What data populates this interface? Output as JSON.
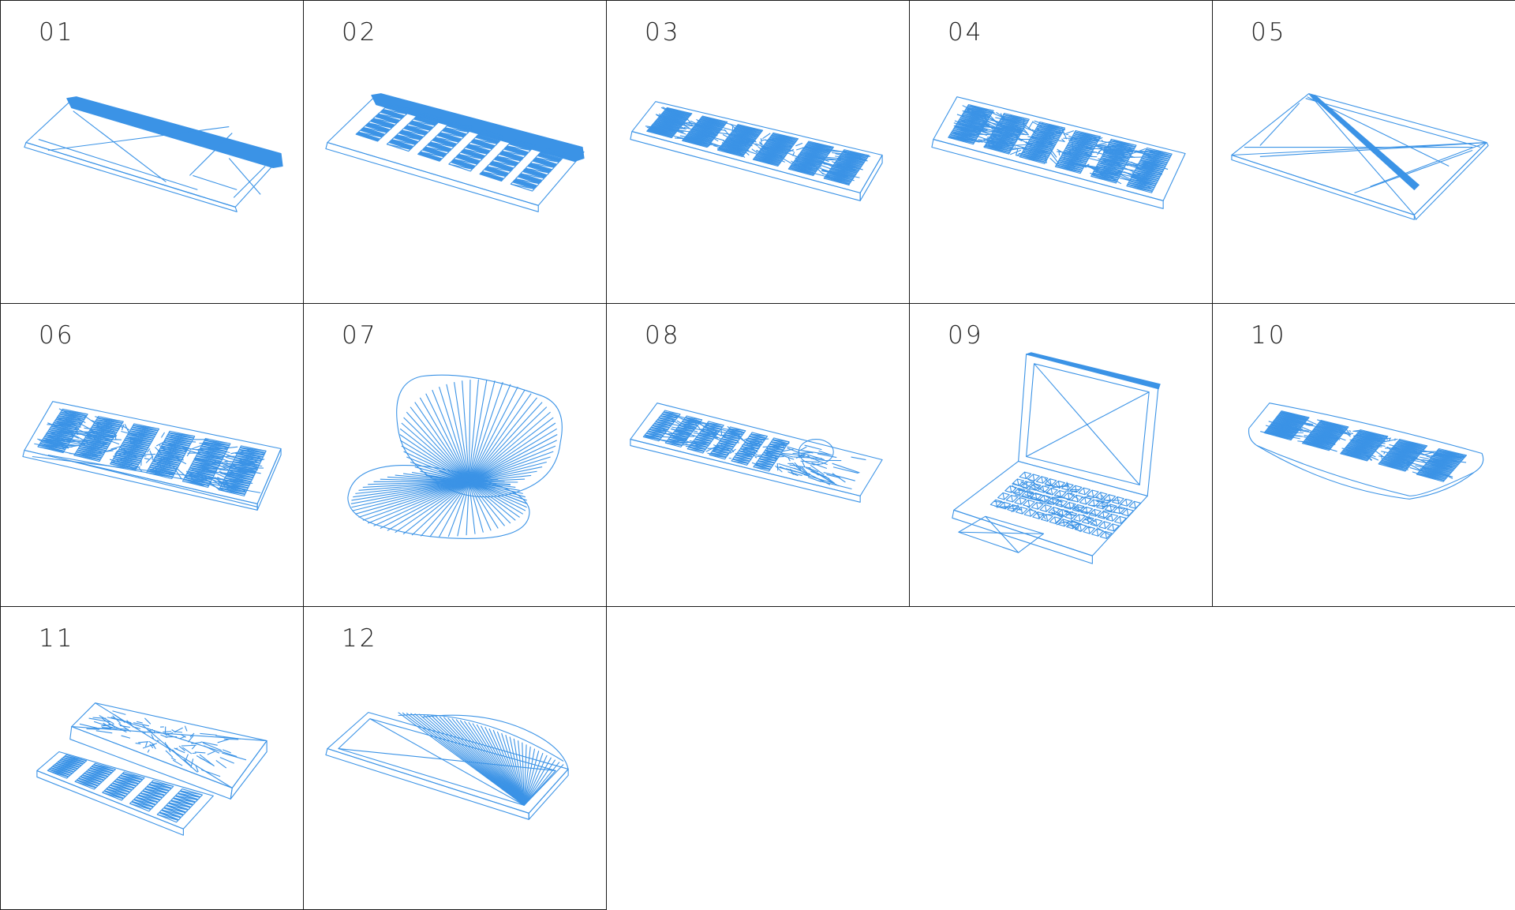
{
  "wire_color": "#3b93e6",
  "border_color": "#1a1a1a",
  "thumbnails": [
    {
      "label": "01",
      "icon": "flat-keyboard-with-trackpad-wireframe"
    },
    {
      "label": "02",
      "icon": "compact-keyboard-wireframe"
    },
    {
      "label": "03",
      "icon": "full-keyboard-wireframe"
    },
    {
      "label": "04",
      "icon": "full-keyboard-wireframe-dense"
    },
    {
      "label": "05",
      "icon": "flat-slab-keyboard-wireframe"
    },
    {
      "label": "06",
      "icon": "keyboard-with-stand-wireframe"
    },
    {
      "label": "07",
      "icon": "curved-clamshell-wireframe"
    },
    {
      "label": "08",
      "icon": "keyboard-with-mouse-wireframe"
    },
    {
      "label": "09",
      "icon": "laptop-wireframe"
    },
    {
      "label": "10",
      "icon": "ergonomic-keyboard-wireframe"
    },
    {
      "label": "11",
      "icon": "slider-device-wireframe"
    },
    {
      "label": "12",
      "icon": "wedge-keyboard-wireframe"
    }
  ]
}
